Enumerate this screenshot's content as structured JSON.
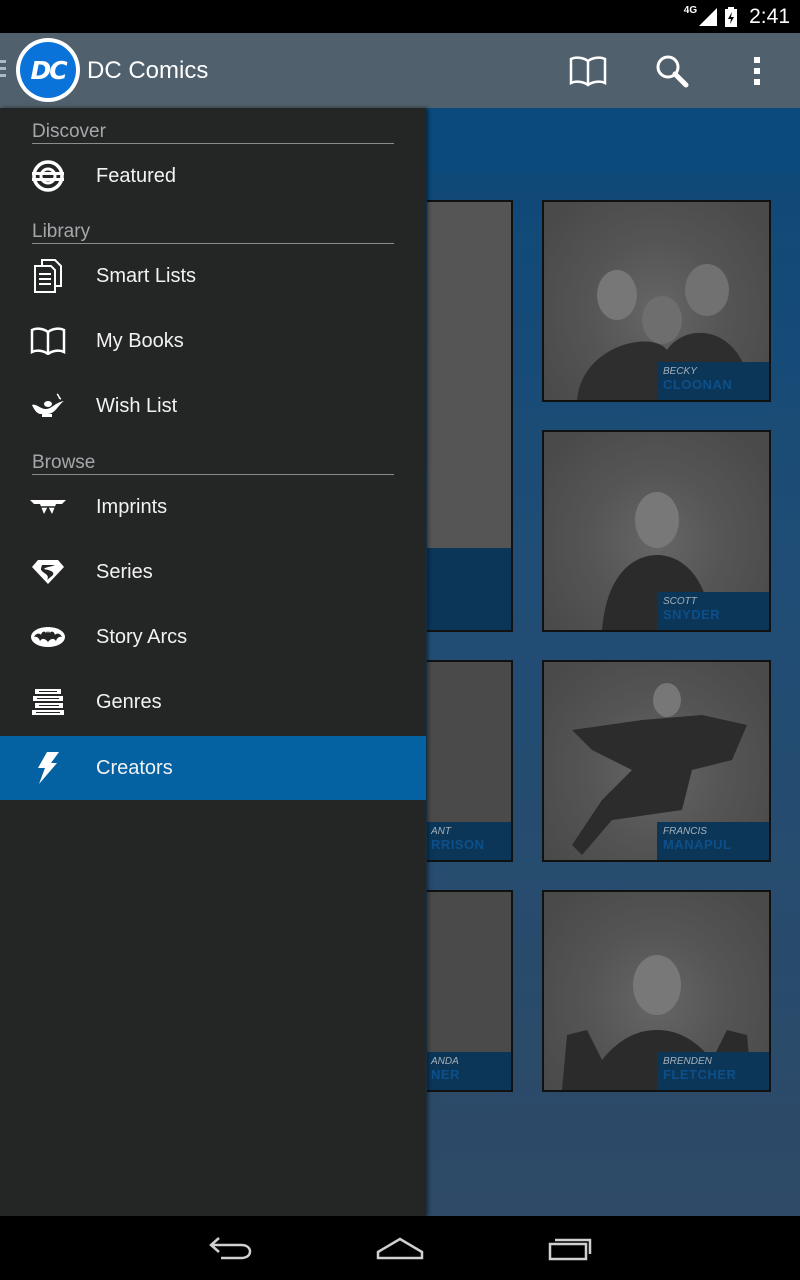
{
  "status_bar": {
    "network": "4G",
    "time": "2:41"
  },
  "app_bar": {
    "logo_text": "DC",
    "title": "DC Comics",
    "actions": [
      "book-icon",
      "search-icon",
      "overflow-menu-icon"
    ]
  },
  "drawer": {
    "sections": [
      {
        "header": "Discover"
      },
      {
        "header": "Library"
      },
      {
        "header": "Browse"
      }
    ],
    "items": [
      {
        "label": "Featured",
        "icon": "lantern-icon"
      },
      {
        "label": "Smart Lists",
        "icon": "documents-icon"
      },
      {
        "label": "My Books",
        "icon": "open-book-icon"
      },
      {
        "label": "Wish List",
        "icon": "genie-lamp-icon"
      },
      {
        "label": "Imprints",
        "icon": "wonder-woman-icon"
      },
      {
        "label": "Series",
        "icon": "superman-icon"
      },
      {
        "label": "Story Arcs",
        "icon": "batman-icon"
      },
      {
        "label": "Genres",
        "icon": "book-stack-icon"
      },
      {
        "label": "Creators",
        "icon": "lightning-icon",
        "selected": true
      }
    ]
  },
  "creators": [
    {
      "first": "BECKY",
      "last": "CLOONAN"
    },
    {
      "first": "SCOTT",
      "last": "SNYDER"
    },
    {
      "first": "FRANCIS",
      "last": "MANAPUL"
    },
    {
      "first": "BRENDEN",
      "last": "FLETCHER"
    }
  ],
  "partial_creators": [
    {
      "first": "ANT",
      "last": "RRISON"
    },
    {
      "first": "ANDA",
      "last": "NER"
    }
  ],
  "colors": {
    "app_bar": "#50606c",
    "drawer_bg": "#242525",
    "selected_item": "#0462a3",
    "dc_blue": "#0a73d9"
  }
}
